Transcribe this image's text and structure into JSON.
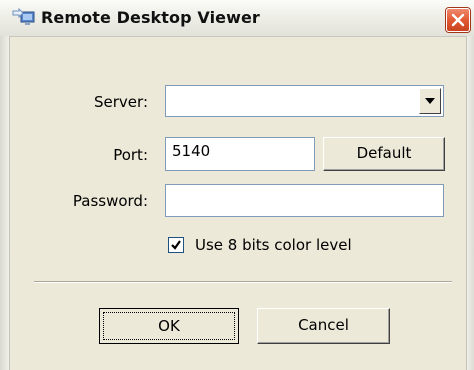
{
  "window": {
    "title": "Remote Desktop Viewer",
    "icon": "remote-desktop-app-icon",
    "close_icon": "close-icon"
  },
  "form": {
    "server": {
      "label": "Server:",
      "value": "",
      "dropdown_icon": "chevron-down-icon"
    },
    "port": {
      "label": "Port:",
      "value": "5140"
    },
    "default_button": "Default",
    "password": {
      "label": "Password:",
      "value": ""
    },
    "color_checkbox": {
      "label": "Use 8 bits color level",
      "checked": true
    }
  },
  "buttons": {
    "ok": "OK",
    "cancel": "Cancel"
  },
  "colors": {
    "dialog_bg": "#ece9d8",
    "close_button": "#e25a33",
    "field_border": "#7f9db9"
  }
}
